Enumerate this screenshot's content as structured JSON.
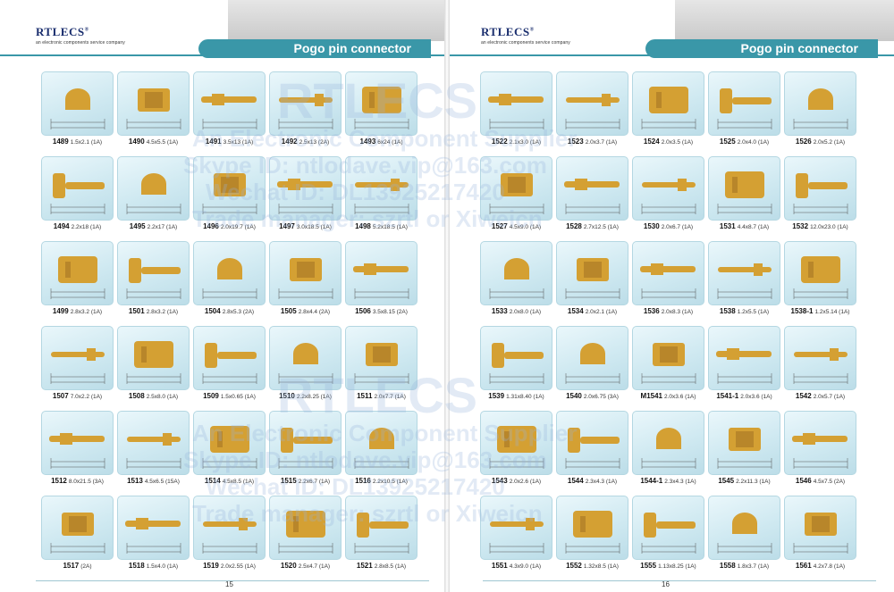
{
  "brand": {
    "name": "RTLECS",
    "mark": "®",
    "tagline": "an electronic components service company"
  },
  "colors": {
    "accent": "#3a97a8",
    "gold": "#d4a033",
    "tile": "#d9eef5",
    "text": "#222222"
  },
  "watermark": {
    "lines": [
      "RTLECS",
      "An Electronic Component Supplier",
      "Skype ID: ntlodave.vip@163.com",
      "Wechat ID: DL13925217420",
      "Trade manager: szrtl or Xiweicn"
    ]
  },
  "pages": [
    {
      "title": "Pogo pin connector",
      "page_number": "15",
      "items": [
        {
          "code": "1489",
          "spec": "1.5x2.1 (1A)"
        },
        {
          "code": "1490",
          "spec": "4.5x5.5 (1A)"
        },
        {
          "code": "1491",
          "spec": "3.5x13 (1A)"
        },
        {
          "code": "1492",
          "spec": "2.5x13 (2A)"
        },
        {
          "code": "1493",
          "spec": "6x24 (1A)"
        },
        {
          "code": "1494",
          "spec": "2.2x18 (1A)"
        },
        {
          "code": "1495",
          "spec": "2.2x17 (1A)"
        },
        {
          "code": "1496",
          "spec": "2.0x19.7 (1A)"
        },
        {
          "code": "1497",
          "spec": "3.0x18.5 (1A)"
        },
        {
          "code": "1498",
          "spec": "5.2x18.5 (1A)"
        },
        {
          "code": "1499",
          "spec": "2.8x3.2 (1A)"
        },
        {
          "code": "1501",
          "spec": "2.8x3.2 (1A)"
        },
        {
          "code": "1504",
          "spec": "2.8x5.3 (2A)"
        },
        {
          "code": "1505",
          "spec": "2.8x4.4 (2A)"
        },
        {
          "code": "1506",
          "spec": "3.5x8.15 (2A)"
        },
        {
          "code": "1507",
          "spec": "7.0x2.2 (1A)"
        },
        {
          "code": "1508",
          "spec": "2.5x8.0 (1A)"
        },
        {
          "code": "1509",
          "spec": "1.5x0.65 (1A)"
        },
        {
          "code": "1510",
          "spec": "2.2x8.25 (1A)"
        },
        {
          "code": "1511",
          "spec": "2.0x7.7 (1A)"
        },
        {
          "code": "1512",
          "spec": "8.0x21.5 (3A)"
        },
        {
          "code": "1513",
          "spec": "4.5x6.5 (15A)"
        },
        {
          "code": "1514",
          "spec": "4.5x8.5 (1A)"
        },
        {
          "code": "1515",
          "spec": "2.2x6.7 (1A)"
        },
        {
          "code": "1516",
          "spec": "2.2x10.5 (1A)"
        },
        {
          "code": "1517",
          "spec": "(2A)"
        },
        {
          "code": "1518",
          "spec": "1.5x4.0 (1A)"
        },
        {
          "code": "1519",
          "spec": "2.0x2.55 (1A)"
        },
        {
          "code": "1520",
          "spec": "2.5x4.7 (1A)"
        },
        {
          "code": "1521",
          "spec": "2.8x8.5 (1A)"
        }
      ]
    },
    {
      "title": "Pogo pin connector",
      "page_number": "16",
      "items": [
        {
          "code": "1522",
          "spec": "2.1x3.0 (1A)"
        },
        {
          "code": "1523",
          "spec": "2.0x3.7 (1A)"
        },
        {
          "code": "1524",
          "spec": "2.0x3.5 (1A)"
        },
        {
          "code": "1525",
          "spec": "2.0x4.0 (1A)"
        },
        {
          "code": "1526",
          "spec": "2.0x5.2 (1A)"
        },
        {
          "code": "1527",
          "spec": "4.5x9.0 (1A)"
        },
        {
          "code": "1528",
          "spec": "2.7x12.5 (1A)"
        },
        {
          "code": "1530",
          "spec": "2.0x6.7 (1A)"
        },
        {
          "code": "1531",
          "spec": "4.4x8.7 (1A)"
        },
        {
          "code": "1532",
          "spec": "12.0x23.0 (1A)"
        },
        {
          "code": "1533",
          "spec": "2.0x8.0 (1A)"
        },
        {
          "code": "1534",
          "spec": "2.0x2.1 (1A)"
        },
        {
          "code": "1536",
          "spec": "2.0x8.3 (1A)"
        },
        {
          "code": "1538",
          "spec": "1.2x5.5 (1A)"
        },
        {
          "code": "1538-1",
          "spec": "1.2x5.14 (1A)"
        },
        {
          "code": "1539",
          "spec": "1.31x8.40 (1A)"
        },
        {
          "code": "1540",
          "spec": "2.0x6.75 (3A)"
        },
        {
          "code": "M1541",
          "spec": "2.0x3.6 (1A)"
        },
        {
          "code": "1541-1",
          "spec": "2.0x3.6 (1A)"
        },
        {
          "code": "1542",
          "spec": "2.0x5.7 (1A)"
        },
        {
          "code": "1543",
          "spec": "2.0x2.6 (1A)"
        },
        {
          "code": "1544",
          "spec": "2.3x4.3 (1A)"
        },
        {
          "code": "1544-1",
          "spec": "2.3x4.3 (1A)"
        },
        {
          "code": "1545",
          "spec": "2.2x11.3 (1A)"
        },
        {
          "code": "1546",
          "spec": "4.5x7.5 (2A)"
        },
        {
          "code": "1551",
          "spec": "4.3x9.0 (1A)"
        },
        {
          "code": "1552",
          "spec": "1.32x8.5 (1A)"
        },
        {
          "code": "1555",
          "spec": "1.13x8.25 (1A)"
        },
        {
          "code": "1558",
          "spec": "1.8x3.7 (1A)"
        },
        {
          "code": "1561",
          "spec": "4.2x7.8 (1A)"
        }
      ]
    }
  ]
}
